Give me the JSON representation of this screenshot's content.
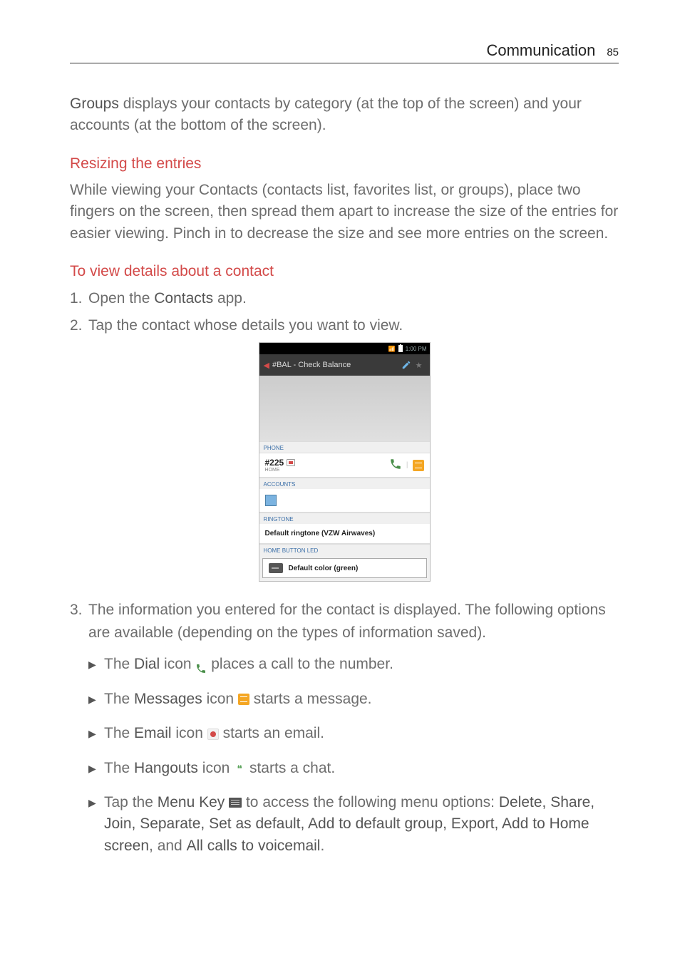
{
  "header": {
    "title": "Communication",
    "page": "85"
  },
  "intro": {
    "groups_bold": "Groups",
    "groups_rest": " displays your contacts by category (at the top of the screen) and your accounts (at the bottom of the screen)."
  },
  "resize": {
    "heading": "Resizing the entries",
    "body": "While viewing your Contacts (contacts list, favorites list, or groups), place two fingers on the screen, then spread them apart to increase the size of the entries for easier viewing. Pinch in to decrease the size and see more entries on the screen."
  },
  "viewdetails": {
    "heading": "To view details about a contact",
    "step1_pre": "Open the ",
    "step1_bold": "Contacts",
    "step1_post": " app.",
    "step2": "Tap the contact whose details you want to view.",
    "step3": "The information you entered for the contact is displayed. The following options are available (depending on the types of information saved).",
    "sub": {
      "dial_pre": "The ",
      "dial_bold": "Dial",
      "dial_mid": " icon ",
      "dial_post": " places a call to the number.",
      "msg_pre": "The ",
      "msg_bold": "Messages",
      "msg_mid": " icon ",
      "msg_post": " starts a message.",
      "email_pre": "The ",
      "email_bold": "Email",
      "email_mid": " icon ",
      "email_post": " starts an email.",
      "hang_pre": "The ",
      "hang_bold": "Hangouts",
      "hang_mid": " icon ",
      "hang_post": " starts a chat.",
      "menu_pre": "Tap the ",
      "menu_bold": "Menu Key",
      "menu_mid": " ",
      "menu_post1": " to access the following menu options: ",
      "menu_opts": "Delete, Share, Join, Separate, Set as default, Add to default group, Export, Add to Home screen",
      "menu_and": ", and ",
      "menu_last": "All calls to voicemail",
      "menu_period": "."
    }
  },
  "screenshot": {
    "status_time": "1:00 PM",
    "title": "#BAL - Check Balance",
    "label_phone": "PHONE",
    "number": "#225",
    "number_type": "HOME",
    "label_accounts": "ACCOUNTS",
    "label_ringtone": "RINGTONE",
    "ringtone": "Default ringtone (VZW Airwaves)",
    "label_led": "HOME BUTTON LED",
    "led": "Default color (green)"
  }
}
